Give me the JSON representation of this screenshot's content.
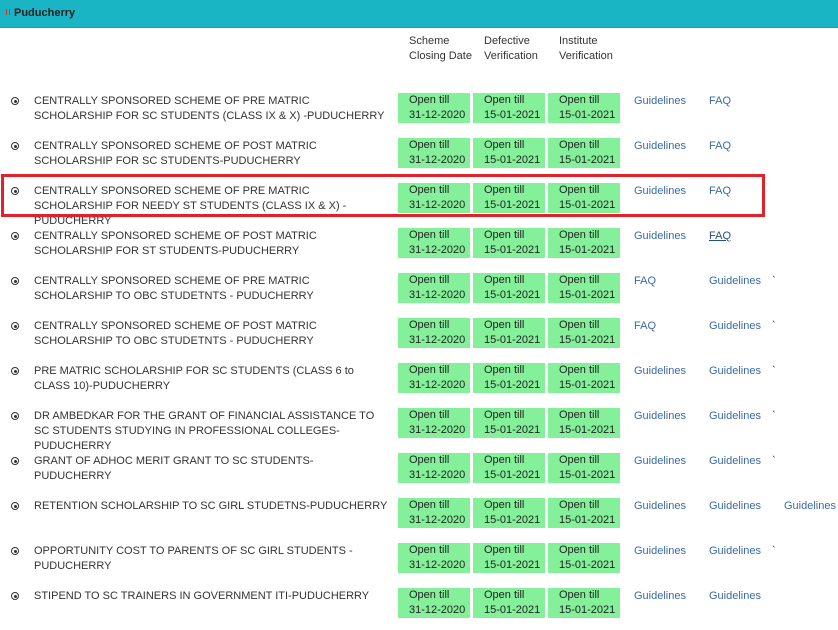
{
  "header": {
    "title": "Puducherry"
  },
  "columns": {
    "closing": "Scheme Closing Date",
    "defective": "Defective Verification",
    "institute": "Institute Verification"
  },
  "rows": [
    {
      "name": "CENTRALLY SPONSORED SCHEME OF PRE MATRIC SCHOLARSHIP FOR SC STUDENTS (CLASS IX & X) -PUDUCHERRY",
      "closing": "Open till 31-12-2020",
      "defective": "Open till 15-01-2021",
      "institute": "Open till 15-01-2021",
      "link1": "Guidelines",
      "link2": "FAQ",
      "link3": "",
      "tick": ""
    },
    {
      "name": "CENTRALLY SPONSORED SCHEME OF POST MATRIC SCHOLARSHIP FOR SC STUDENTS-PUDUCHERRY",
      "closing": "Open till 31-12-2020",
      "defective": "Open till 15-01-2021",
      "institute": "Open till 15-01-2021",
      "link1": "Guidelines",
      "link2": "FAQ",
      "link3": "",
      "tick": ""
    },
    {
      "name": "CENTRALLY SPONSORED SCHEME OF PRE MATRIC SCHOLARSHIP FOR NEEDY ST STUDENTS (CLASS IX & X) -PUDUCHERRY",
      "closing": "Open till 31-12-2020",
      "defective": "Open till 15-01-2021",
      "institute": "Open till 15-01-2021",
      "link1": "Guidelines",
      "link2": "FAQ",
      "link3": "",
      "tick": ""
    },
    {
      "name": "CENTRALLY SPONSORED SCHEME OF POST MATRIC SCHOLARSHIP FOR ST STUDENTS-PUDUCHERRY",
      "closing": "Open till 31-12-2020",
      "defective": "Open till 15-01-2021",
      "institute": "Open till 15-01-2021",
      "link1": "Guidelines",
      "link2": "FAQ",
      "link3": "",
      "tick": ""
    },
    {
      "name": "CENTRALLY SPONSORED SCHEME OF PRE MATRIC SCHOLARSHIP TO OBC STUDETNTS - PUDUCHERRY",
      "closing": "Open till 31-12-2020",
      "defective": "Open till 15-01-2021",
      "institute": "Open till 15-01-2021",
      "link1": "FAQ",
      "link2": "Guidelines",
      "link3": "",
      "tick": "`"
    },
    {
      "name": "CENTRALLY SPONSORED SCHEME OF POST MATRIC SCHOLARSHIP TO OBC STUDETNTS - PUDUCHERRY",
      "closing": "Open till 31-12-2020",
      "defective": "Open till 15-01-2021",
      "institute": "Open till 15-01-2021",
      "link1": "FAQ",
      "link2": "Guidelines",
      "link3": "",
      "tick": "`"
    },
    {
      "name": "PRE MATRIC SCHOLARSHIP FOR SC STUDENTS (CLASS 6 to CLASS 10)-PUDUCHERRY",
      "closing": "Open till 31-12-2020",
      "defective": "Open till 15-01-2021",
      "institute": "Open till 15-01-2021",
      "link1": "Guidelines",
      "link2": "Guidelines",
      "link3": "",
      "tick": "`"
    },
    {
      "name": "DR AMBEDKAR FOR THE GRANT OF FINANCIAL ASSISTANCE TO SC STUDENTS STUDYING IN PROFESSIONAL COLLEGES-PUDUCHERRY",
      "closing": "Open till 31-12-2020",
      "defective": "Open till 15-01-2021",
      "institute": "Open till 15-01-2021",
      "link1": "Guidelines",
      "link2": "Guidelines",
      "link3": "",
      "tick": "`"
    },
    {
      "name": "GRANT OF ADHOC MERIT GRANT TO SC STUDENTS-PUDUCHERRY",
      "closing": "Open till 31-12-2020",
      "defective": "Open till 15-01-2021",
      "institute": "Open till 15-01-2021",
      "link1": "Guidelines",
      "link2": "Guidelines",
      "link3": "",
      "tick": "`"
    },
    {
      "name": "RETENTION SCHOLARSHIP TO SC GIRL STUDETNS-PUDUCHERRY",
      "closing": "Open till 31-12-2020",
      "defective": "Open till 15-01-2021",
      "institute": "Open till 15-01-2021",
      "link1": "Guidelines",
      "link2": "Guidelines",
      "link3": "Guidelines",
      "tick": ""
    },
    {
      "name": "OPPORTUNITY COST TO PARENTS OF SC GIRL STUDENTS - PUDUCHERRY",
      "closing": "Open till 31-12-2020",
      "defective": "Open till 15-01-2021",
      "institute": "Open till 15-01-2021",
      "link1": "Guidelines",
      "link2": "Guidelines",
      "link3": "",
      "tick": "`"
    },
    {
      "name": "STIPEND TO SC TRAINERS IN GOVERNMENT ITI-PUDUCHERRY",
      "closing": "Open till 31-12-2020",
      "defective": "Open till 15-01-2021",
      "institute": "Open till 15-01-2021",
      "link1": "Guidelines",
      "link2": "Guidelines",
      "link3": "",
      "tick": ""
    }
  ]
}
